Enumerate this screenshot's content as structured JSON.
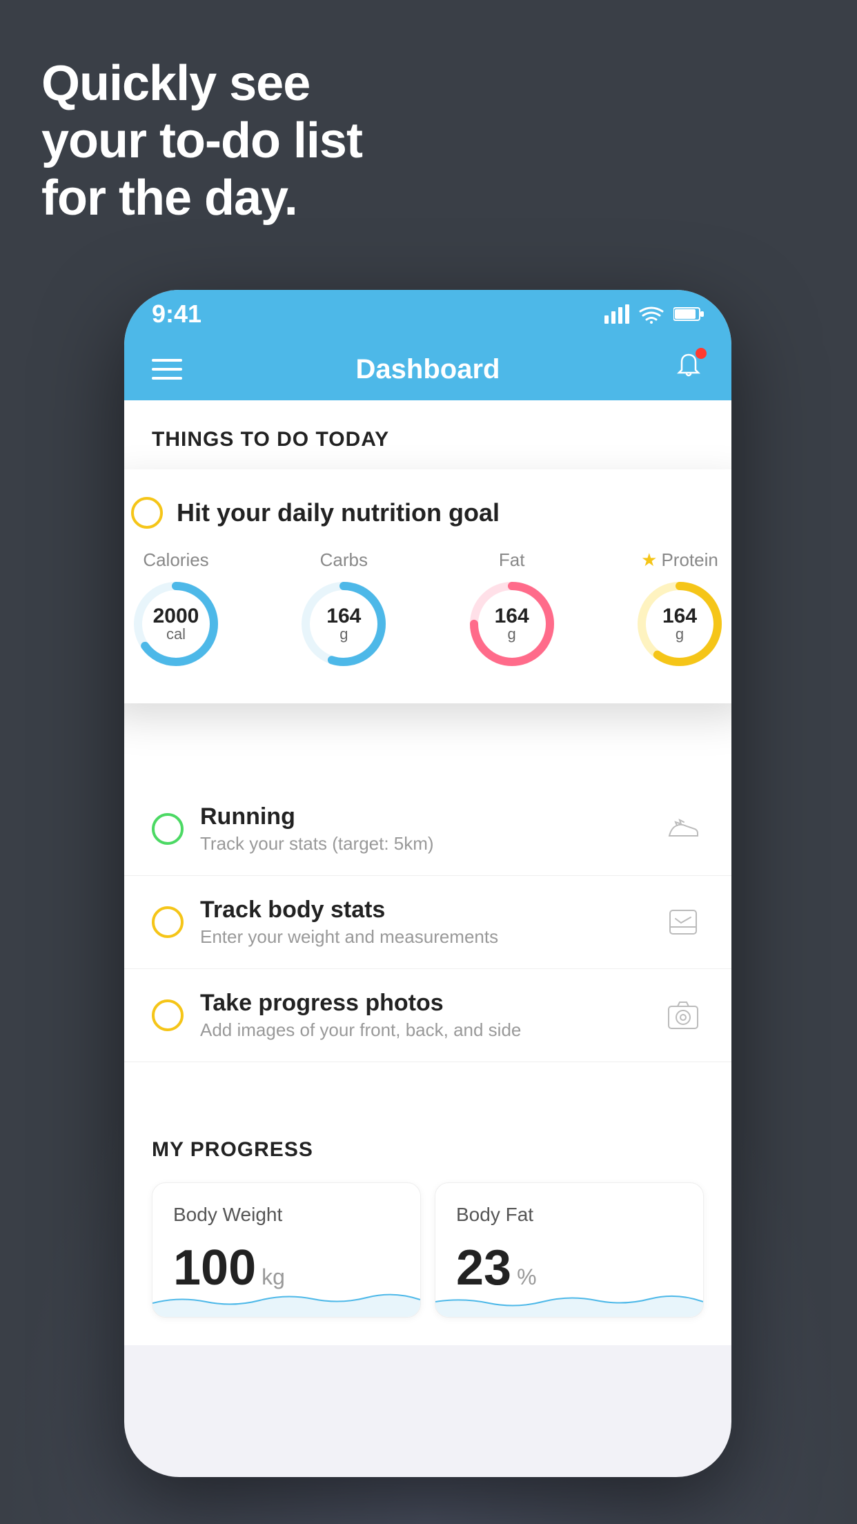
{
  "background": {
    "color": "#3a3f47"
  },
  "hero": {
    "line1": "Quickly see",
    "line2": "your to-do list",
    "line3": "for the day."
  },
  "phone": {
    "statusBar": {
      "time": "9:41",
      "signalIcon": "signal-icon",
      "wifiIcon": "wifi-icon",
      "batteryIcon": "battery-icon"
    },
    "navBar": {
      "menuIcon": "menu-icon",
      "title": "Dashboard",
      "notificationIcon": "bell-icon"
    },
    "thingsToDoSection": {
      "heading": "THINGS TO DO TODAY"
    },
    "floatingCard": {
      "title": "Hit your daily nutrition goal",
      "nutrients": [
        {
          "label": "Calories",
          "value": "2000",
          "unit": "cal",
          "color": "#4db8e8",
          "progress": 65,
          "starred": false
        },
        {
          "label": "Carbs",
          "value": "164",
          "unit": "g",
          "color": "#4db8e8",
          "progress": 55,
          "starred": false
        },
        {
          "label": "Fat",
          "value": "164",
          "unit": "g",
          "color": "#ff6b8a",
          "progress": 75,
          "starred": false
        },
        {
          "label": "Protein",
          "value": "164",
          "unit": "g",
          "color": "#f5c518",
          "progress": 60,
          "starred": true
        }
      ]
    },
    "todoItems": [
      {
        "id": "running",
        "title": "Running",
        "subtitle": "Track your stats (target: 5km)",
        "radioColor": "#4cd964",
        "icon": "shoe-icon",
        "completed": false
      },
      {
        "id": "track-body-stats",
        "title": "Track body stats",
        "subtitle": "Enter your weight and measurements",
        "radioColor": "#f5c518",
        "icon": "scale-icon",
        "completed": false
      },
      {
        "id": "progress-photos",
        "title": "Take progress photos",
        "subtitle": "Add images of your front, back, and side",
        "radioColor": "#f5c518",
        "icon": "photo-icon",
        "completed": false
      }
    ],
    "progressSection": {
      "heading": "MY PROGRESS",
      "cards": [
        {
          "title": "Body Weight",
          "value": "100",
          "unit": "kg"
        },
        {
          "title": "Body Fat",
          "value": "23",
          "unit": "%"
        }
      ]
    }
  }
}
